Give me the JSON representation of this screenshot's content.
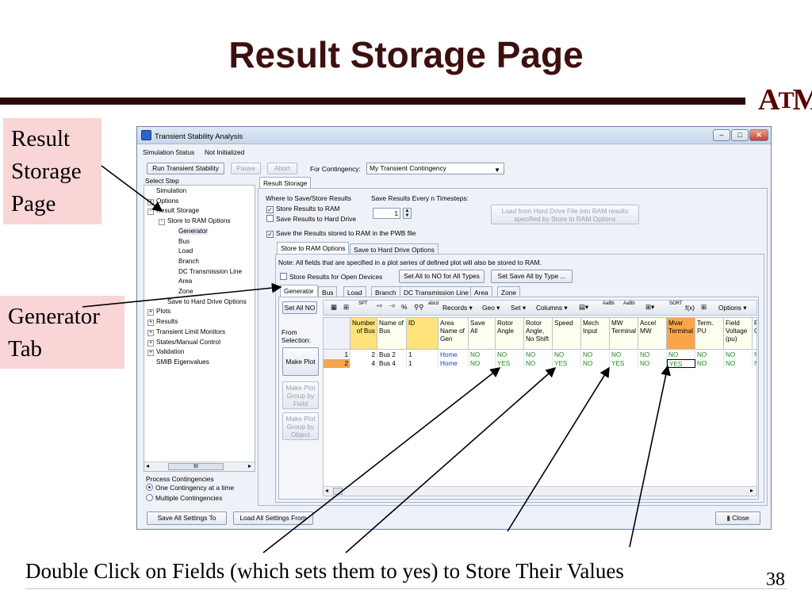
{
  "slide": {
    "title": "Result Storage Page",
    "logo_left": "A",
    "logo_mid": "T",
    "logo_right": "M",
    "callout_result": [
      "Result",
      "Storage",
      "Page"
    ],
    "callout_generator": [
      "Generator",
      "Tab"
    ],
    "caption": "Double Click on Fields (which sets them to yes) to Store Their Values",
    "page_number": "38"
  },
  "window": {
    "title": "Transient Stability Analysis",
    "status_label": "Simulation Status",
    "status_value": "Not Initialized",
    "btn_run": "Run Transient Stability",
    "btn_pause": "Pause",
    "btn_abort": "Abort",
    "contingency_label": "For Contingency:",
    "contingency_value": "My Transient Contingency",
    "select_step": "Select Step",
    "tree": [
      {
        "label": "Simulation",
        "indent": 0,
        "exp": ""
      },
      {
        "label": "Options",
        "indent": 0,
        "exp": "+"
      },
      {
        "label": "Result Storage",
        "indent": 0,
        "exp": "-"
      },
      {
        "label": "Store to RAM Options",
        "indent": 1,
        "exp": "-"
      },
      {
        "label": "Generator",
        "indent": 2,
        "exp": ""
      },
      {
        "label": "Bus",
        "indent": 2,
        "exp": ""
      },
      {
        "label": "Load",
        "indent": 2,
        "exp": ""
      },
      {
        "label": "Branch",
        "indent": 2,
        "exp": ""
      },
      {
        "label": "DC Transmission Line",
        "indent": 2,
        "exp": ""
      },
      {
        "label": "Area",
        "indent": 2,
        "exp": ""
      },
      {
        "label": "Zone",
        "indent": 2,
        "exp": ""
      },
      {
        "label": "Save to Hard Drive Options",
        "indent": 1,
        "exp": ""
      },
      {
        "label": "Plots",
        "indent": 0,
        "exp": "+"
      },
      {
        "label": "Results",
        "indent": 0,
        "exp": "+"
      },
      {
        "label": "Transient Limit Monitors",
        "indent": 0,
        "exp": "+"
      },
      {
        "label": "States/Manual Control",
        "indent": 0,
        "exp": "+"
      },
      {
        "label": "Validation",
        "indent": 0,
        "exp": "+"
      },
      {
        "label": "SMIB Eigenvalues",
        "indent": 0,
        "exp": ""
      }
    ],
    "scroll_thumb": "III",
    "process_label": "Process Contingencies",
    "radio_one": "One Contingency at a time",
    "radio_multi": "Multiple Contingencies",
    "btn_save_all": "Save All Settings To",
    "btn_load_all": "Load All Settings From",
    "btn_close": "Close",
    "main_tab": "Result Storage",
    "where_label": "Where to Save/Store Results",
    "chk_ram": "Store Results to RAM",
    "chk_hd": "Save Results to Hard Drive",
    "every_label": "Save Results Every n Timesteps:",
    "every_value": "1",
    "btn_load_hd": [
      "Load from Hard Drive File into RAM results",
      "specified by Store to RAM Options"
    ],
    "chk_pwb": "Save the Results stored to RAM in the PWB file",
    "subtab_ram": "Store to RAM Options",
    "subtab_hd": "Save to Hard Drive Options",
    "note": "Note: All fields that are specified in a plot series of defined plot will also be stored to RAM.",
    "chk_open": "Store Results for Open Devices",
    "btn_set_no": "Set All to NO for All Types",
    "btn_set_type": "Set Save All by Type ...",
    "obj_tabs": [
      "Generator",
      "Bus",
      "Load",
      "Branch",
      "DC Transmission Line",
      "Area",
      "Zone"
    ],
    "btn_set_all_no": "Set All NO",
    "toolbar": {
      "records": "Records",
      "geo": "Geo",
      "set": "Set",
      "columns": "Columns",
      "fx": "f(x)",
      "options": "Options",
      "icon_small_1": "SPT",
      "icon_small_2": "AaBb",
      "icon_small_3": "SORT"
    },
    "from_selection": [
      "From",
      "Selection:"
    ],
    "btn_make_plot": "Make Plot",
    "btn_plot_field": [
      "Make Plot",
      "Group by",
      "Field"
    ],
    "btn_plot_object": [
      "Make Plot",
      "Group by",
      "Object"
    ],
    "columns": [
      {
        "label": "Number of Bus",
        "w": 34,
        "style": "yellow"
      },
      {
        "label": "Name of Bus",
        "w": 37,
        "style": "plain"
      },
      {
        "label": "ID",
        "w": 40,
        "style": "yellow"
      },
      {
        "label": "Area Name of Gen",
        "w": 38,
        "style": "plain"
      },
      {
        "label": "Save All",
        "w": 34,
        "style": "plain"
      },
      {
        "label": "Rotor Angle",
        "w": 36,
        "style": "plain"
      },
      {
        "label": "Rotor Angle, No Shift",
        "w": 36,
        "style": "plain"
      },
      {
        "label": "Speed",
        "w": 36,
        "style": "plain"
      },
      {
        "label": "Mech Input",
        "w": 36,
        "style": "plain"
      },
      {
        "label": "MW Terminal",
        "w": 36,
        "style": "plain"
      },
      {
        "label": "Accel MW",
        "w": 36,
        "style": "plain"
      },
      {
        "label": "Mvar Terminal",
        "w": 36,
        "style": "orange"
      },
      {
        "label": "Term. PU",
        "w": 36,
        "style": "plain"
      },
      {
        "label": "Field Voltage (pu)",
        "w": 36,
        "style": "plain"
      },
      {
        "label": "Fi Cu",
        "w": 10,
        "style": "plain"
      }
    ],
    "rows": [
      {
        "num": "1",
        "cells": [
          "2",
          "Bus 2",
          "1",
          "Home",
          "NO",
          "NO",
          "NO",
          "NO",
          "NO",
          "NO",
          "NO",
          "NO",
          "NO",
          "NO",
          "NC"
        ]
      },
      {
        "num": "2",
        "cells": [
          "4",
          "Bus 4",
          "1",
          "Home",
          "NO",
          "YES",
          "NO",
          "YES",
          "NO",
          "YES",
          "NO",
          "YES",
          "NO",
          "NO",
          "NC"
        ]
      }
    ]
  }
}
